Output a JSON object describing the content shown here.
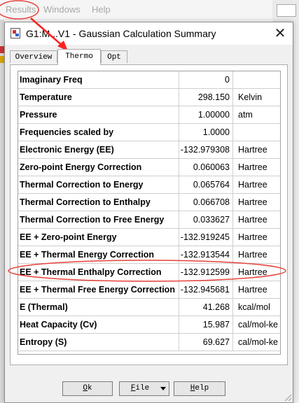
{
  "menubar": {
    "items": [
      "Results",
      "Windows",
      "Help"
    ]
  },
  "window": {
    "title": "G1:M...V1 - Gaussian Calculation Summary",
    "close": "✕"
  },
  "tabs": [
    {
      "label": "Overview",
      "active": false
    },
    {
      "label": "Thermo",
      "active": true
    },
    {
      "label": "Opt",
      "active": false
    }
  ],
  "table": {
    "rows": [
      {
        "label": "Imaginary Freq",
        "value": "0",
        "unit": ""
      },
      {
        "label": "Temperature",
        "value": "298.150",
        "unit": "Kelvin"
      },
      {
        "label": "Pressure",
        "value": "1.00000",
        "unit": "atm"
      },
      {
        "label": "Frequencies scaled by",
        "value": "1.0000",
        "unit": ""
      },
      {
        "label": "Electronic Energy (EE)",
        "value": "-132.979308",
        "unit": "Hartree"
      },
      {
        "label": "Zero-point Energy Correction",
        "value": "0.060063",
        "unit": "Hartree"
      },
      {
        "label": "Thermal Correction to Energy",
        "value": "0.065764",
        "unit": "Hartree"
      },
      {
        "label": "Thermal Correction to Enthalpy",
        "value": "0.066708",
        "unit": "Hartree"
      },
      {
        "label": "Thermal Correction to Free Energy",
        "value": "0.033627",
        "unit": "Hartree"
      },
      {
        "label": "EE + Zero-point Energy",
        "value": "-132.919245",
        "unit": "Hartree"
      },
      {
        "label": "EE + Thermal Energy Correction",
        "value": "-132.913544",
        "unit": "Hartree"
      },
      {
        "label": "EE + Thermal Enthalpy Correction",
        "value": "-132.912599",
        "unit": "Hartree"
      },
      {
        "label": "EE + Thermal Free Energy Correction",
        "value": "-132.945681",
        "unit": "Hartree"
      },
      {
        "label": "E (Thermal)",
        "value": "41.268",
        "unit": "kcal/mol"
      },
      {
        "label": "Heat Capacity (Cv)",
        "value": "15.987",
        "unit": "cal/mol-ke"
      },
      {
        "label": "Entropy (S)",
        "value": "69.627",
        "unit": "cal/mol-ke"
      }
    ]
  },
  "buttons": {
    "ok": {
      "mnemonic": "O",
      "rest": "k"
    },
    "file": {
      "mnemonic": "F",
      "rest": "ile"
    },
    "help": {
      "mnemonic": "H",
      "rest": "elp"
    }
  },
  "colors": {
    "annotation": "#e8413c",
    "arrow": "#ff2020"
  },
  "icons": {
    "close": "close-icon",
    "app": "gaussview-app-icon",
    "dropdown": "chevron-down-icon"
  }
}
